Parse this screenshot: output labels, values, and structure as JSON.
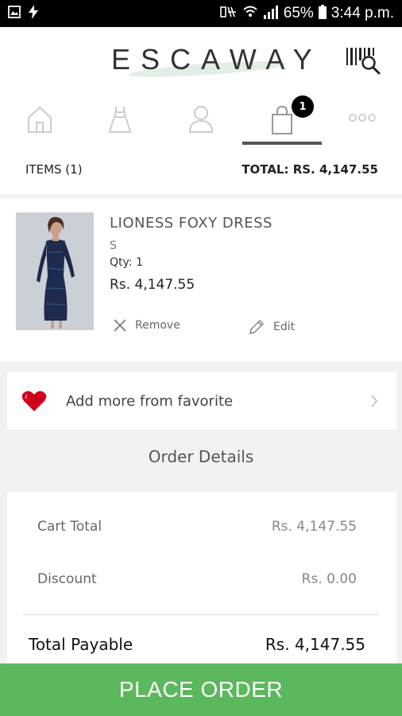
{
  "status_bar": {
    "battery_percent": "65%",
    "time": "3:44 p.m."
  },
  "app": {
    "logo_text": "ESCAWAY"
  },
  "nav": {
    "tabs": [
      {
        "icon": "home-icon"
      },
      {
        "icon": "dress-icon"
      },
      {
        "icon": "user-icon"
      },
      {
        "icon": "shopping-bag-icon",
        "active": true,
        "badge": "1"
      },
      {
        "icon": "more-icon"
      }
    ]
  },
  "cart_summary": {
    "items_label": "ITEMS (1)",
    "total_label": "TOTAL: RS. 4,147.55"
  },
  "product": {
    "name": "LIONESS FOXY DRESS",
    "size": "S",
    "qty": "Qty: 1",
    "price": "Rs. 4,147.55",
    "remove_label": "Remove",
    "edit_label": "Edit"
  },
  "favorite": {
    "label": "Add more from favorite"
  },
  "order_details": {
    "title": "Order Details",
    "cart_total_label": "Cart Total",
    "cart_total_value": "Rs. 4,147.55",
    "discount_label": "Discount",
    "discount_value": "Rs. 0.00",
    "total_payable_label": "Total Payable",
    "total_payable_value": "Rs. 4,147.55"
  },
  "place_order_label": "PLACE ORDER",
  "colors": {
    "accent_green": "#5cb85c",
    "heart_red": "#d0021b",
    "status_bar": "#000000"
  }
}
